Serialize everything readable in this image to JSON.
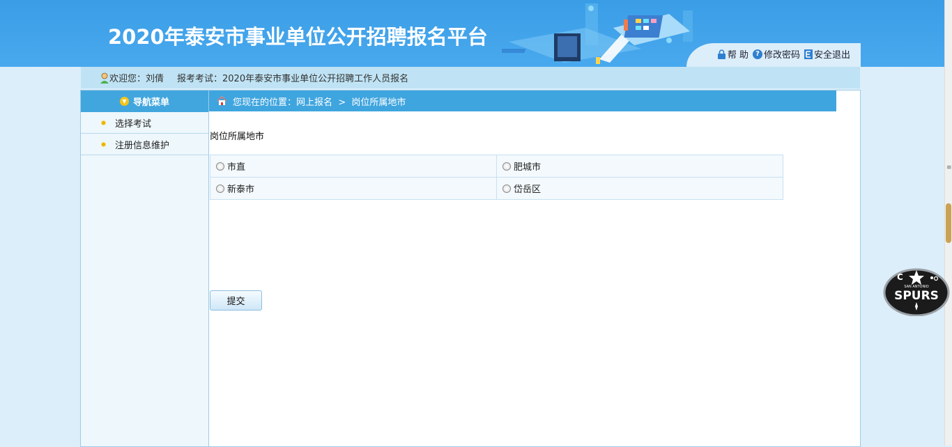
{
  "header": {
    "title": "2020年泰安市事业单位公开招聘报名平台",
    "links": [
      {
        "label": "帮 助",
        "icon": "lock-icon"
      },
      {
        "label": "修改密码",
        "icon": "question-icon"
      },
      {
        "label": "安全退出",
        "icon": "exit-icon"
      }
    ]
  },
  "welcome": {
    "greeting": "欢迎您：刘倩",
    "exam": "报考考试：2020年泰安市事业单位公开招聘工作人员报名"
  },
  "sidebar": {
    "title": "导航菜单",
    "items": [
      {
        "label": "选择考试"
      },
      {
        "label": "注册信息维护"
      }
    ]
  },
  "breadcrumb": {
    "text": "您现在的位置：网上报名  >  岗位所属地市"
  },
  "form": {
    "section_title": "岗位所属地市",
    "options": [
      [
        "市直",
        "肥城市"
      ],
      [
        "新泰市",
        "岱岳区"
      ]
    ],
    "submit_label": "提交"
  },
  "overlay": {
    "logo_text": "SPURS",
    "logo_subtext": "SAN ANTONIO"
  },
  "colors": {
    "header_blue": "#3a9de6",
    "bar_blue": "#3fa5df",
    "welcome_bg": "#bfe3f4"
  }
}
